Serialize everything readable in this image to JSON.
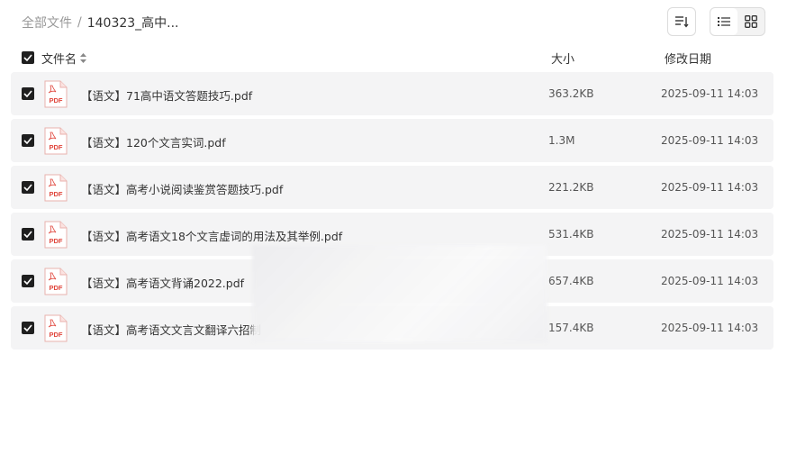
{
  "breadcrumb": {
    "root": "全部文件",
    "separator": "/",
    "current": "140323_高中..."
  },
  "toolbar": {
    "sort_icon": "sort-icon",
    "list_view_icon": "list-view-icon",
    "grid_view_icon": "grid-view-icon"
  },
  "header": {
    "name": "文件名",
    "size": "大小",
    "date": "修改日期"
  },
  "files": [
    {
      "name": "【语文】71高中语文答题技巧.pdf",
      "size": "363.2KB",
      "date": "2025-09-11 14:03",
      "icon": "pdf-file-icon"
    },
    {
      "name": "【语文】120个文言实词.pdf",
      "size": "1.3M",
      "date": "2025-09-11 14:03",
      "icon": "pdf-file-icon"
    },
    {
      "name": "【语文】高考小说阅读鉴赏答题技巧.pdf",
      "size": "221.2KB",
      "date": "2025-09-11 14:03",
      "icon": "pdf-file-icon"
    },
    {
      "name": "【语文】高考语文18个文言虚词的用法及其举例.pdf",
      "size": "531.4KB",
      "date": "2025-09-11 14:03",
      "icon": "pdf-file-icon"
    },
    {
      "name": "【语文】高考语文背诵2022.pdf",
      "size": "657.4KB",
      "date": "2025-09-11 14:03",
      "icon": "pdf-file-icon"
    },
    {
      "name": "【语文】高考语文文言文翻译六招制",
      "size": "157.4KB",
      "date": "2025-09-11 14:03",
      "icon": "pdf-file-icon"
    }
  ],
  "pdf_badge": "PDF",
  "colors": {
    "row_bg": "#f4f4f5",
    "checkbox": "#1f1f1f",
    "pdf_red": "#e0463c"
  }
}
